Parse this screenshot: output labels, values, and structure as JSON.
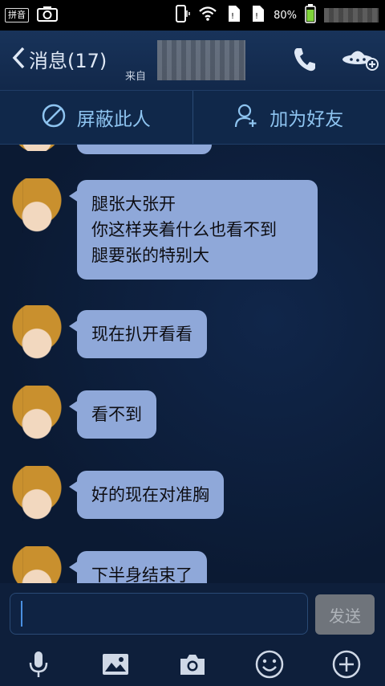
{
  "status_bar": {
    "ime_label": "拼音",
    "battery_percent": "80%"
  },
  "header": {
    "back_label": "消息(17)",
    "contact_subtitle": "来自"
  },
  "action_bar": {
    "block_label": "屏蔽此人",
    "add_friend_label": "加为好友"
  },
  "messages": [
    {
      "text": "腿张大张开\n你这样夹着什么也看不到\n腿要张的特别大"
    },
    {
      "text": "现在扒开看看"
    },
    {
      "text": "看不到"
    },
    {
      "text": "好的现在对准胸"
    },
    {
      "text": "下半身结束了"
    }
  ],
  "input": {
    "value": "",
    "send_label": "发送"
  },
  "toolbar": {
    "icons": [
      "microphone-icon",
      "image-icon",
      "camera-icon",
      "emoji-icon",
      "plus-icon"
    ]
  },
  "colors": {
    "bubble": "#8fa8d9",
    "accent": "#8ec4f0",
    "background": "#0b1a33"
  }
}
